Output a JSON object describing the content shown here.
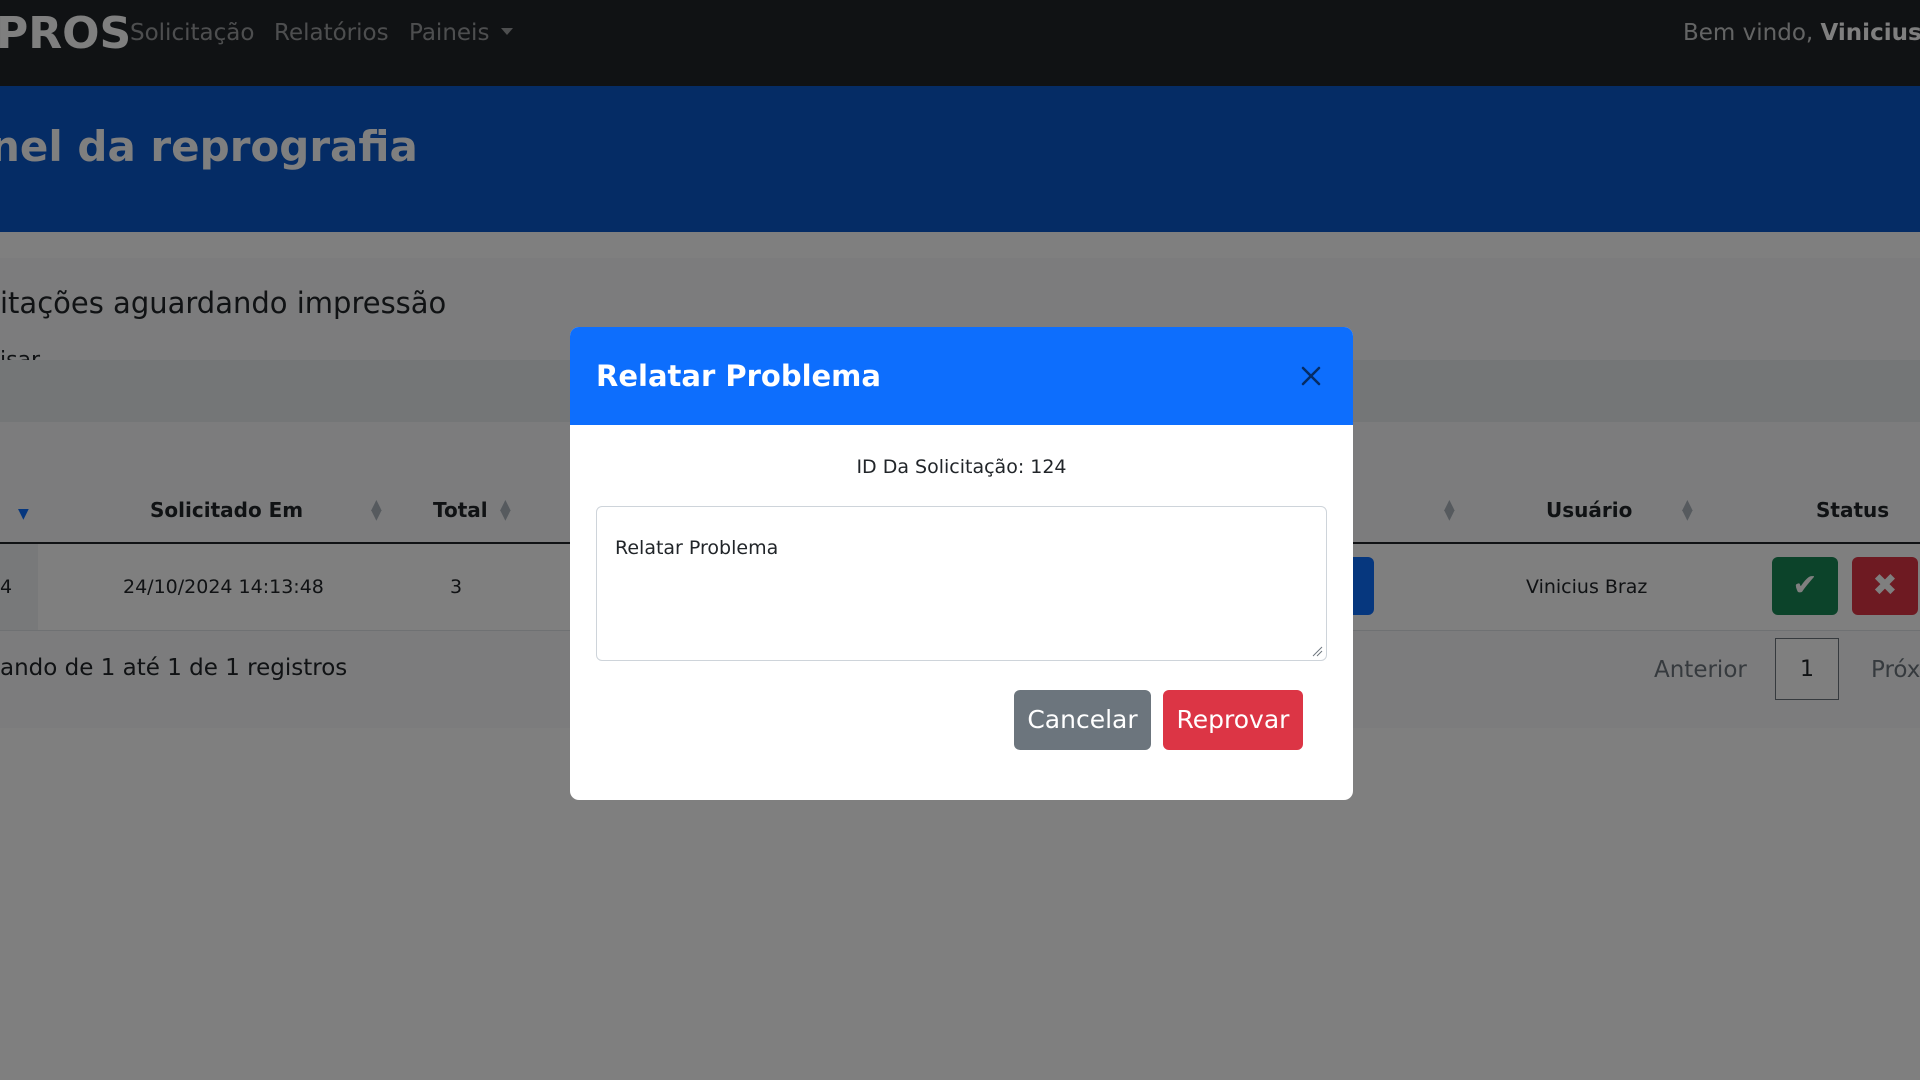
{
  "navbar": {
    "brand": "PROS",
    "links": [
      "Solicitação",
      "Relatórios",
      "Paineis"
    ],
    "welcome_prefix": "Bem vindo, ",
    "user_name": "Vinicius B"
  },
  "hero": {
    "title": "nel da reprografia"
  },
  "card": {
    "title": "itações aguardando impressão",
    "search_label": "isar"
  },
  "table": {
    "headers": {
      "requested_at": "Solicitado Em",
      "total": "Total",
      "user": "Usuário",
      "status": "Status"
    },
    "row": {
      "id_fragment": "4",
      "requested_at": "24/10/2024 14:13:48",
      "total": "3",
      "user": "Vinicius Braz"
    }
  },
  "pagination": {
    "info": "ando de 1 até 1 de 1 registros",
    "prev": "Anterior",
    "page": "1",
    "next": "Próx"
  },
  "modal": {
    "title": "Relatar Problema",
    "request_id_text": "ID Da Solicitação: 124",
    "textarea_placeholder": "Relatar Problema",
    "cancel_label": "Cancelar",
    "reject_label": "Reprovar"
  },
  "colors": {
    "navbar": "#212529",
    "hero": "#0a58ca",
    "modal_header": "#0d6efd",
    "cancel": "#6c757d",
    "reject": "#dc3545",
    "approve": "#198754"
  },
  "icons": {
    "close": "close-icon",
    "approve": "check-icon",
    "reject": "x-icon",
    "sort": "sort-icon",
    "caret": "chevron-down-icon"
  }
}
